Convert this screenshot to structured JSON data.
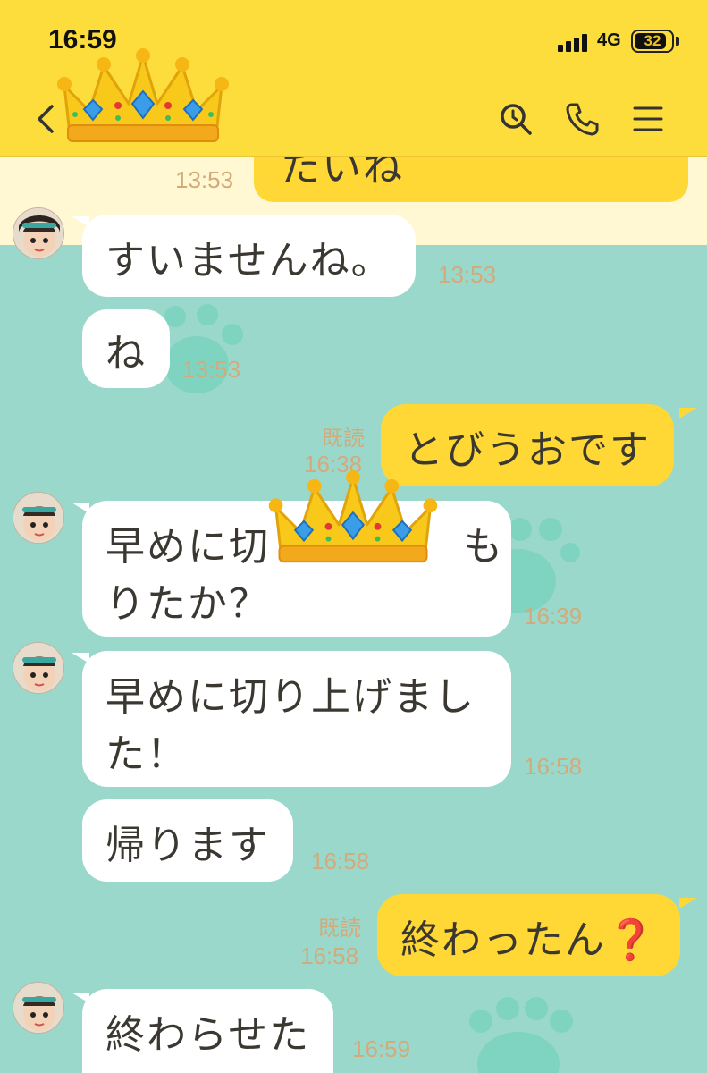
{
  "status_bar": {
    "time": "16:59",
    "network": "4G",
    "battery": "32",
    "battery_level": 0.32
  },
  "header": {
    "back_icon": "chevron-left-icon",
    "name_emoji": "crown",
    "search_icon": "search-icon",
    "call_icon": "phone-icon",
    "menu_icon": "menu-icon",
    "color": "#fddd3b"
  },
  "messages": [
    {
      "side": "out",
      "text": "たいね",
      "time": "13:53",
      "partial": true
    },
    {
      "side": "in",
      "text": "すいませんね。",
      "time": "13:53"
    },
    {
      "side": "in",
      "text": "ね",
      "time": "13:53"
    },
    {
      "side": "out",
      "read": "既読",
      "text": "とびうおです",
      "time": "16:38"
    },
    {
      "side": "in",
      "line1": "早めに切",
      "line1b": "も",
      "line2": "りたか？",
      "time": "16:39",
      "covered_by": "crown"
    },
    {
      "side": "in",
      "line1": "早めに切り上げまし",
      "line2": "た！",
      "time": "16:58"
    },
    {
      "side": "in",
      "text": "帰ります",
      "time": "16:58"
    },
    {
      "side": "out",
      "read": "既読",
      "text": "終わったん",
      "mark": "❓",
      "time": "16:58"
    },
    {
      "side": "in",
      "text": "終わらせた",
      "time": "16:59"
    }
  ],
  "colors": {
    "background": "#9ad8cc",
    "band": "#fff8d2",
    "out_bubble": "#ffd835",
    "in_bubble": "#ffffff",
    "timestamp": "#d1ab7c"
  }
}
